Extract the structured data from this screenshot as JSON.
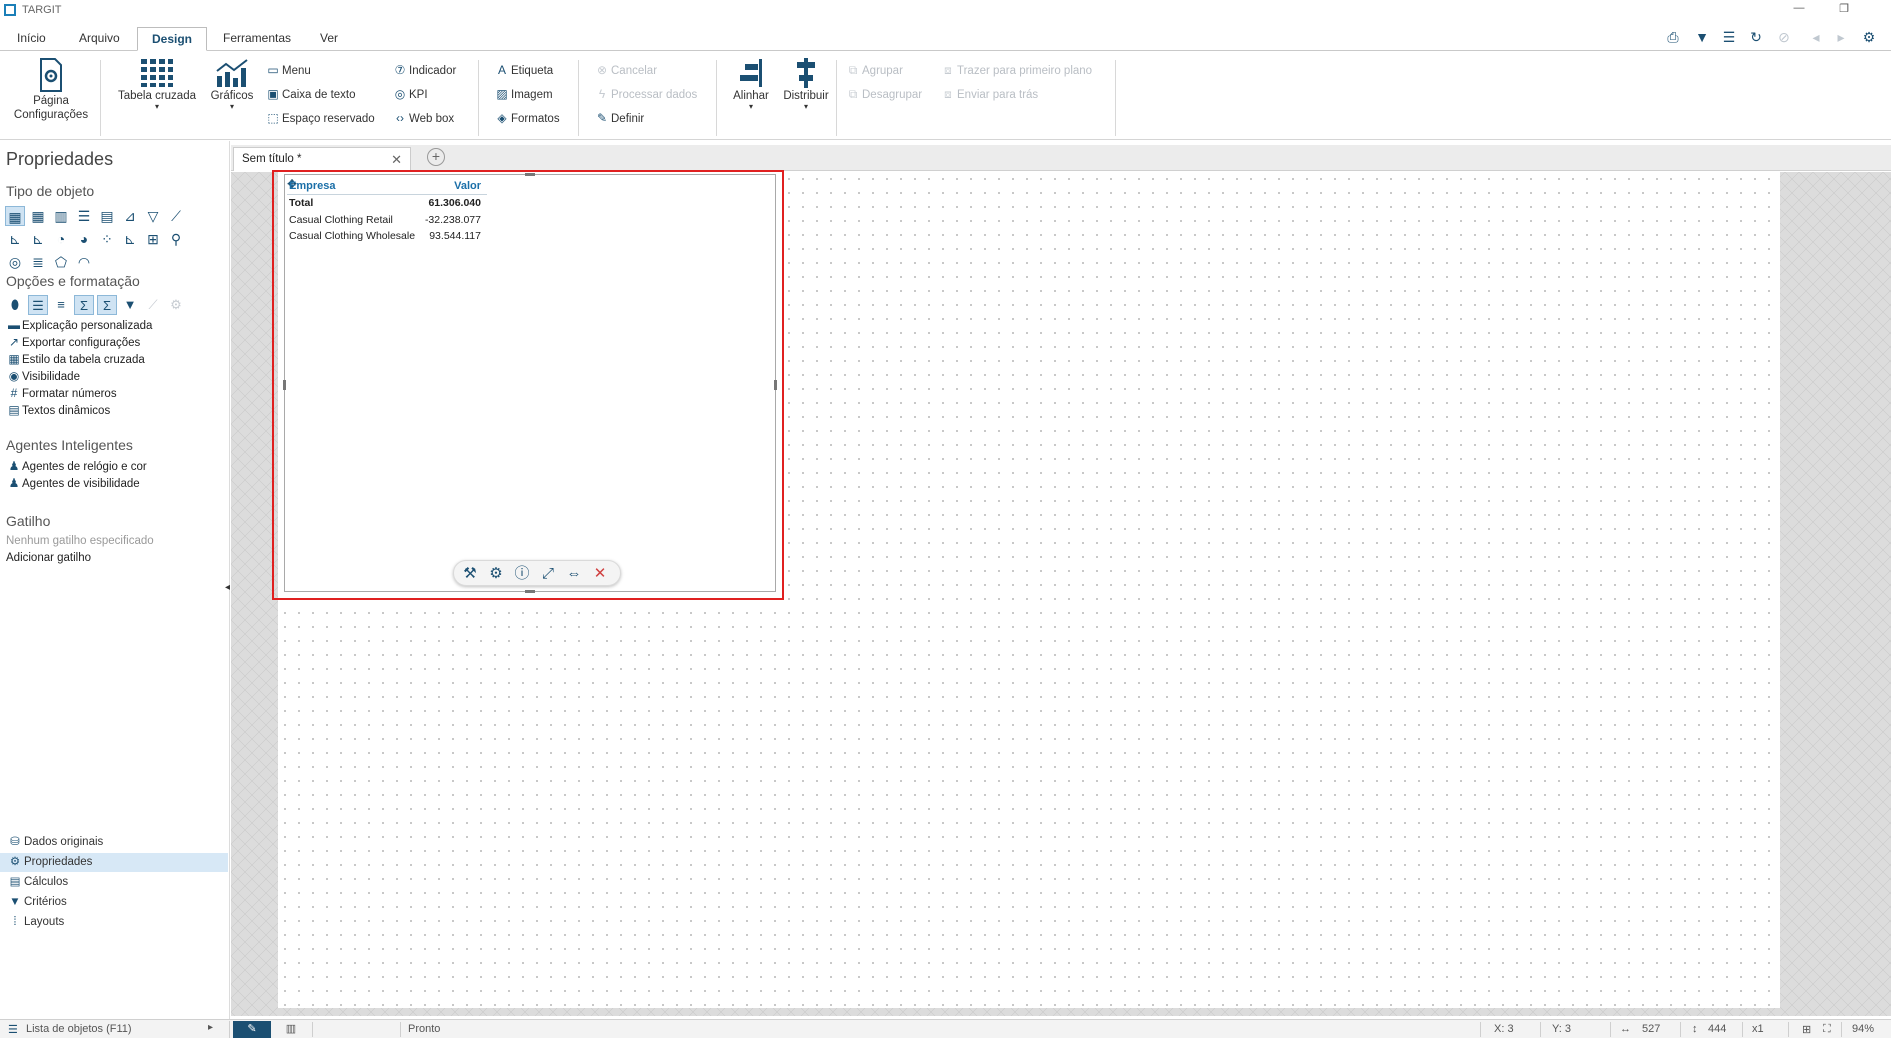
{
  "window": {
    "title": "TARGIT"
  },
  "ribbon_tabs": [
    "Início",
    "Arquivo",
    "Design",
    "Ferramentas",
    "Ver"
  ],
  "ribbon": {
    "page_settings": "Página Configurações",
    "crosstab": "Tabela cruzada",
    "charts": "Gráficos",
    "menu": "Menu",
    "textbox": "Caixa de texto",
    "placeholder": "Espaço reservado",
    "indicator": "Indicador",
    "kpi": "KPI",
    "webbox": "Web box",
    "label": "Etiqueta",
    "image": "Imagem",
    "shapes": "Formatos",
    "cancel": "Cancelar",
    "process": "Processar dados",
    "define": "Definir",
    "align": "Alinhar",
    "distribute": "Distribuir",
    "group": "Agrupar",
    "ungroup": "Desagrupar",
    "bring_front": "Trazer para primeiro plano",
    "send_back": "Enviar para trás"
  },
  "left_panel": {
    "title": "Propriedades",
    "object_type_heading": "Tipo de objeto",
    "options_heading": "Opções e formatação",
    "options_items": [
      "Explicação personalizada",
      "Exportar configurações",
      "Estilo da tabela cruzada",
      "Visibilidade",
      "Formatar números",
      "Textos dinâmicos"
    ],
    "agents_heading": "Agentes Inteligentes",
    "agents_items": [
      "Agentes de relógio e cor",
      "Agentes de visibilidade"
    ],
    "trigger_heading": "Gatilho",
    "trigger_none": "Nenhum gatilho especificado",
    "trigger_add": "Adicionar gatilho",
    "bottom_nav": [
      "Dados originais",
      "Propriedades",
      "Cálculos",
      "Critérios",
      "Layouts"
    ],
    "object_list": "Lista de objetos (F11)"
  },
  "document_tab": {
    "title": "Sem título *"
  },
  "crosstab": {
    "col_dim": "Empresa",
    "col_measure": "Valor",
    "total_label": "Total",
    "total_value": "61.306.040",
    "rows": [
      {
        "label": "Casual Clothing Retail",
        "value": "-32.238.077"
      },
      {
        "label": "Casual Clothing Wholesale",
        "value": "93.544.117"
      }
    ]
  },
  "status": {
    "ready": "Pronto",
    "x": "X: 3",
    "y": "Y: 3",
    "width": "527",
    "height": "444",
    "multiplier": "x1",
    "zoom": "94%"
  },
  "colors": {
    "accent": "#1b4f72",
    "selection": "#e02020",
    "header_text": "#1b6fa8"
  }
}
